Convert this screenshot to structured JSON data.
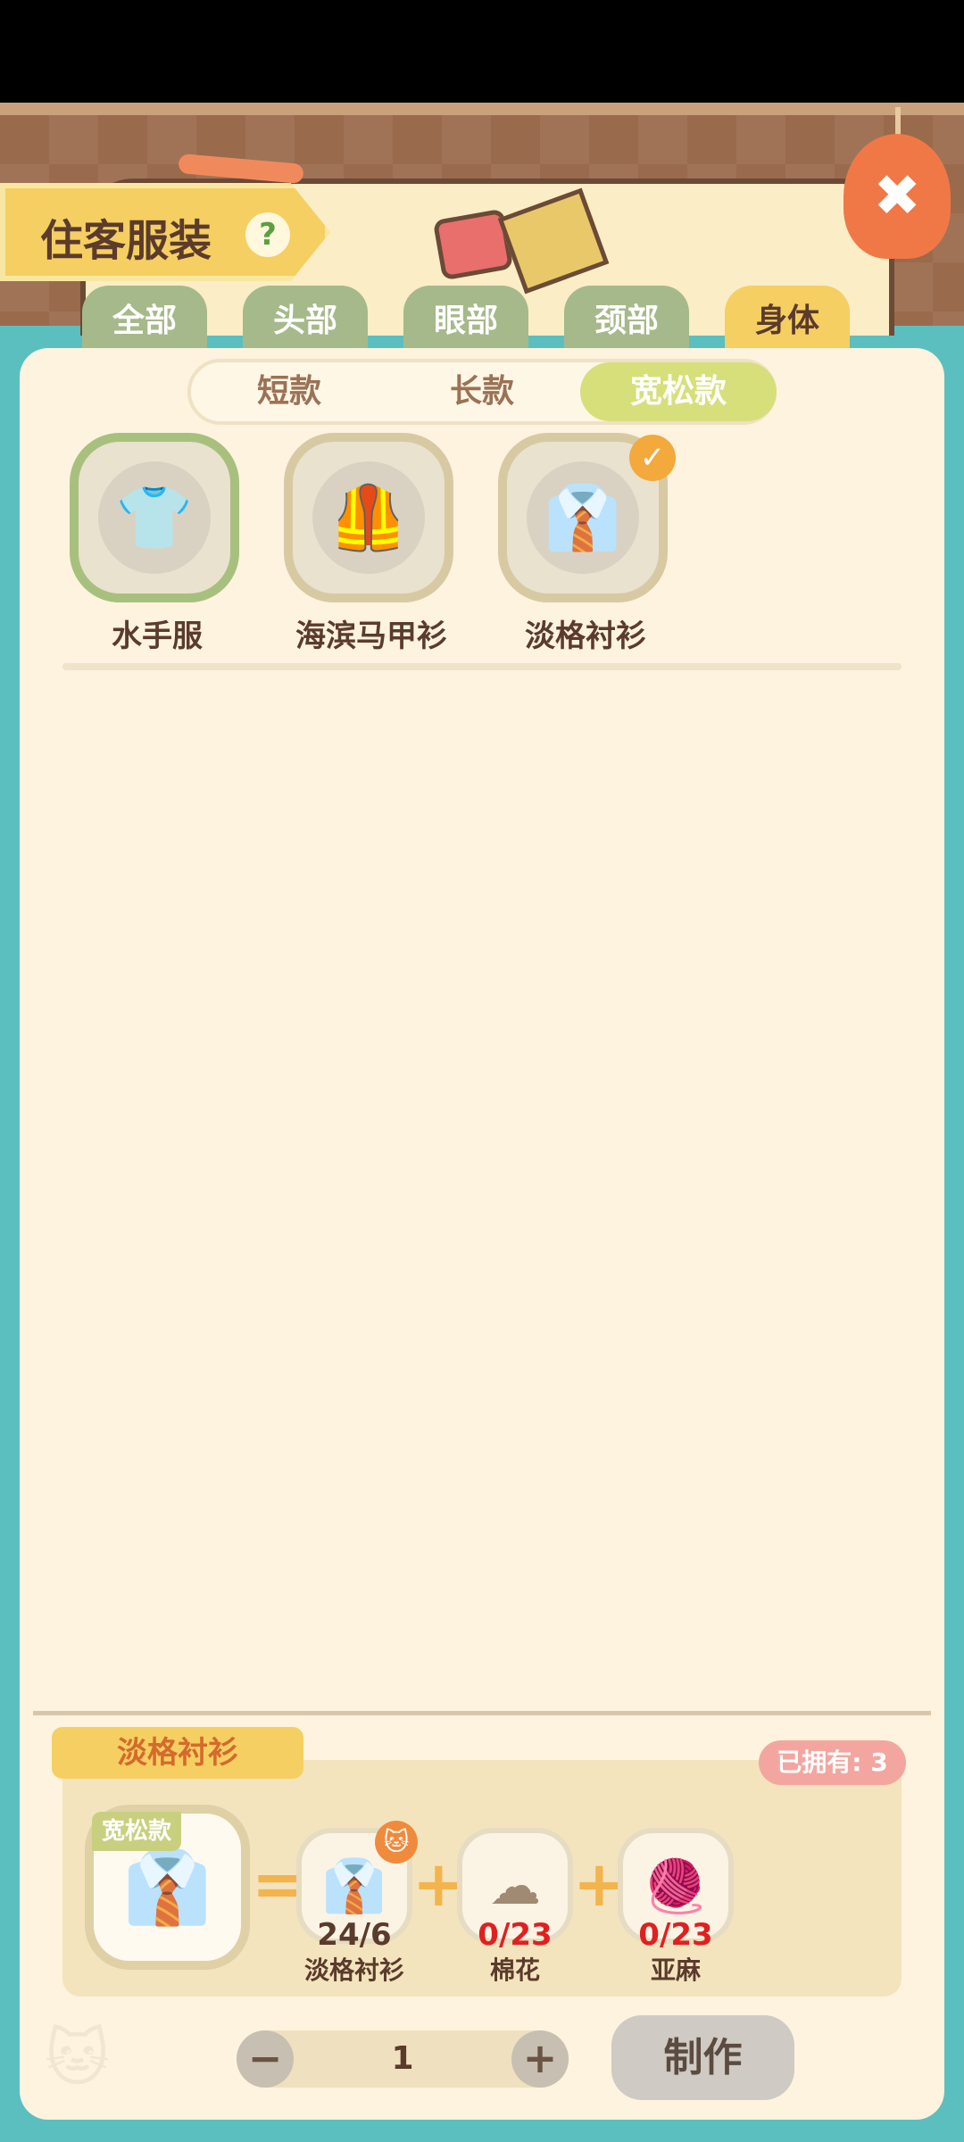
{
  "header": {
    "title": "住客服装",
    "help_icon": "?",
    "close_icon": "✖"
  },
  "category_tabs": [
    {
      "label": "全部",
      "active": false
    },
    {
      "label": "头部",
      "active": false
    },
    {
      "label": "眼部",
      "active": false
    },
    {
      "label": "颈部",
      "active": false
    },
    {
      "label": "身体",
      "active": true
    }
  ],
  "sub_tabs": [
    {
      "label": "短款",
      "active": false
    },
    {
      "label": "长款",
      "active": false
    },
    {
      "label": "宽松款",
      "active": true
    }
  ],
  "items": [
    {
      "label": "水手服",
      "icon": "shirt-icon",
      "state": "selected"
    },
    {
      "label": "海滨马甲衫",
      "icon": "vest-icon",
      "state": "normal"
    },
    {
      "label": "淡格衬衫",
      "icon": "shirt-icon",
      "state": "owned"
    }
  ],
  "recipe": {
    "title": "淡格衬衫",
    "owned": "已拥有: 3",
    "result_tag": "宽松款",
    "equals": "=",
    "plus": "+",
    "ingredients": [
      {
        "count": "24/6",
        "label": "淡格衬衫",
        "short": false,
        "icon": "shirt-icon"
      },
      {
        "count": "0/23",
        "label": "棉花",
        "short": true,
        "icon": "cotton-icon"
      },
      {
        "count": "0/23",
        "label": "亚麻",
        "short": true,
        "icon": "yarn-icon"
      }
    ]
  },
  "controls": {
    "minus": "−",
    "plus": "+",
    "quantity": "1",
    "make_label": "制作"
  },
  "colors": {
    "accent": "#f5cf62",
    "background": "#5bbfbf",
    "panel": "#fdf3df",
    "shortage": "#e02020"
  }
}
